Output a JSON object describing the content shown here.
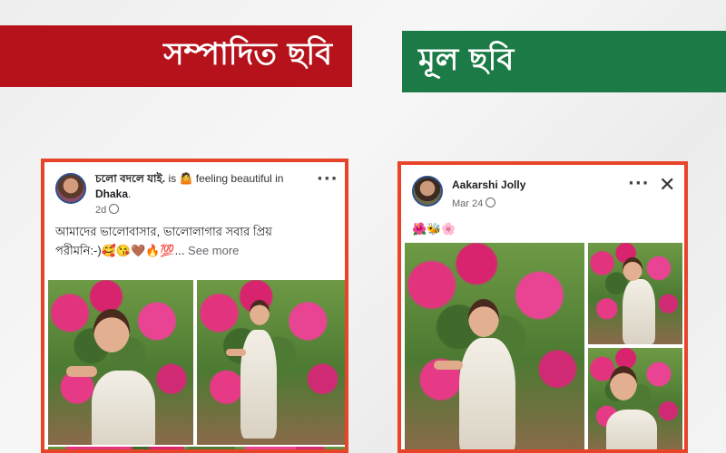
{
  "banners": {
    "edited_label": "সম্পাদিত ছবি",
    "original_label": "মূল ছবি"
  },
  "edited_post": {
    "name": "চলো বদলে যাই.",
    "activity_prefix": " is ",
    "feeling_emoji": "🤷",
    "activity": " feeling beautiful in ",
    "place": "Dhaka",
    "place_suffix": ".",
    "time": "2d",
    "more_icon": "more-icon",
    "text_line1": "আমাদের ভালোবাসার, ভালোলাগার সবার প্রিয়",
    "text_line2": "পরীমনি:-)🥰😘🤎🔥💯...",
    "see_more": " See more"
  },
  "original_post": {
    "name": "Aakarshi Jolly",
    "time": "Mar 24",
    "more_icon": "more-icon",
    "close_icon": "close-icon",
    "emojis": "🌺🐝🌸"
  },
  "colors": {
    "edited_banner": "#b5121b",
    "original_banner": "#1b7a45",
    "post_border": "#e8442a"
  }
}
